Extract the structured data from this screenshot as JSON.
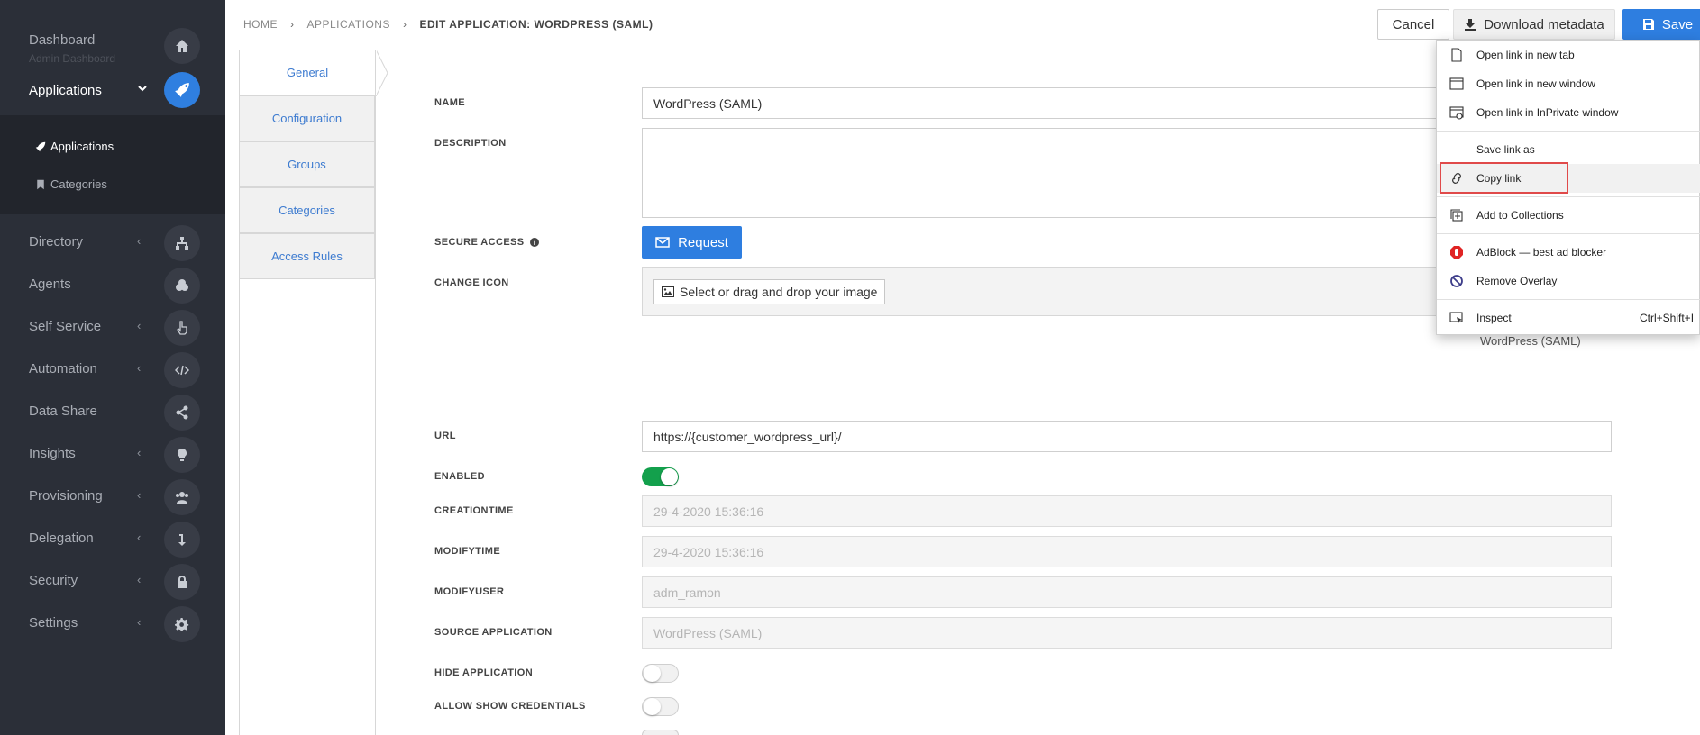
{
  "sidebar": {
    "dashboard": {
      "label": "Dashboard",
      "sub": "Admin Dashboard"
    },
    "applications": {
      "label": "Applications",
      "chevron": "⌄"
    },
    "sub_items": [
      {
        "label": "Applications",
        "icon": "rocket-icon",
        "active": true
      },
      {
        "label": "Categories",
        "icon": "bookmark-icon",
        "active": false
      }
    ],
    "items": [
      {
        "label": "Directory",
        "chevron": "‹",
        "icon": "sitemap-icon"
      },
      {
        "label": "Agents",
        "chevron": "",
        "icon": "cogs-icon"
      },
      {
        "label": "Self Service",
        "chevron": "‹",
        "icon": "hand-pointer-icon"
      },
      {
        "label": "Automation",
        "chevron": "‹",
        "icon": "code-icon"
      },
      {
        "label": "Data Share",
        "chevron": "",
        "icon": "share-icon"
      },
      {
        "label": "Insights",
        "chevron": "‹",
        "icon": "lightbulb-icon"
      },
      {
        "label": "Provisioning",
        "chevron": "‹",
        "icon": "users-icon"
      },
      {
        "label": "Delegation",
        "chevron": "‹",
        "icon": "level-down-icon"
      },
      {
        "label": "Security",
        "chevron": "‹",
        "icon": "lock-icon"
      },
      {
        "label": "Settings",
        "chevron": "‹",
        "icon": "gear-icon"
      }
    ]
  },
  "breadcrumb": {
    "home": "HOME",
    "applications": "APPLICATIONS",
    "current": "EDIT APPLICATION: WORDPRESS (SAML)",
    "separator": "›"
  },
  "toolbar": {
    "cancel_label": "Cancel",
    "download_label": "Download metadata",
    "save_label": "Save"
  },
  "tabs": [
    "General",
    "Configuration",
    "Groups",
    "Categories",
    "Access Rules"
  ],
  "form": {
    "name_label": "NAME",
    "name_value": "WordPress (SAML)",
    "description_label": "DESCRIPTION",
    "secure_access_label": "SECURE ACCESS",
    "request_label": "Request",
    "change_icon_label": "CHANGE ICON",
    "icon_select_label": "Select or drag and drop your image",
    "icon_caption": "WordPress (SAML)",
    "url_label": "URL",
    "url_value": "https://{customer_wordpress_url}/",
    "enabled_label": "ENABLED",
    "enabled_value": true,
    "creationtime_label": "CREATIONTIME",
    "creationtime_value": "29-4-2020 15:36:16",
    "modifytime_label": "MODIFYTIME",
    "modifytime_value": "29-4-2020 15:36:16",
    "modifyuser_label": "MODIFYUSER",
    "modifyuser_value": "adm_ramon",
    "source_label": "SOURCE APPLICATION",
    "source_value": "WordPress (SAML)",
    "hide_label": "HIDE APPLICATION",
    "hide_value": false,
    "allow_label": "ALLOW SHOW CREDENTIALS",
    "allow_value": false
  },
  "context_menu": {
    "items": [
      {
        "label": "Open link in new tab",
        "icon": "new-tab-icon"
      },
      {
        "label": "Open link in new window",
        "icon": "new-window-icon"
      },
      {
        "label": "Open link in InPrivate window",
        "icon": "inprivate-icon"
      },
      {
        "label": "Save link as",
        "icon": ""
      },
      {
        "label": "Copy link",
        "icon": "link-icon"
      },
      {
        "label": "Add to Collections",
        "icon": "collections-icon"
      },
      {
        "label": "AdBlock — best ad blocker",
        "icon": "adblock-icon"
      },
      {
        "label": "Remove Overlay",
        "icon": "remove-overlay-icon"
      },
      {
        "label": "Inspect",
        "icon": "inspect-icon",
        "shortcut": "Ctrl+Shift+I"
      }
    ]
  },
  "colors": {
    "sidebar_bg": "#2b2f38",
    "accent_blue": "#2e7ee0",
    "toggle_on": "#13a04c",
    "highlight_red": "#e04a4a"
  }
}
